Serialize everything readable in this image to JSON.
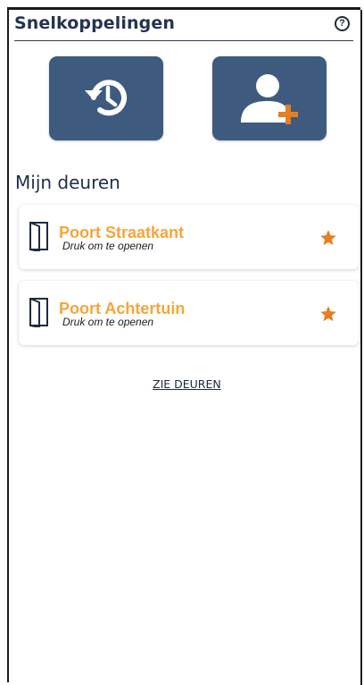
{
  "header": {
    "title": "Snelkoppelingen",
    "help_icon": "help-circle-icon"
  },
  "shortcuts": [
    {
      "icon": "history-icon"
    },
    {
      "icon": "add-user-icon"
    }
  ],
  "colors": {
    "tile": "#3e5b7f",
    "accent": "#f5a63a",
    "star": "#e67e22",
    "title": "#24344f"
  },
  "doors_section": {
    "title": "Mijn deuren",
    "doors": [
      {
        "name": "Poort Straatkant",
        "subtitle": "Druk om te openen",
        "favorite": true,
        "icon": "door-icon"
      },
      {
        "name": "Poort Achtertuin",
        "subtitle": "Druk om te openen",
        "favorite": true,
        "icon": "door-icon"
      }
    ],
    "see_all_label": "ZIE DEUREN"
  }
}
